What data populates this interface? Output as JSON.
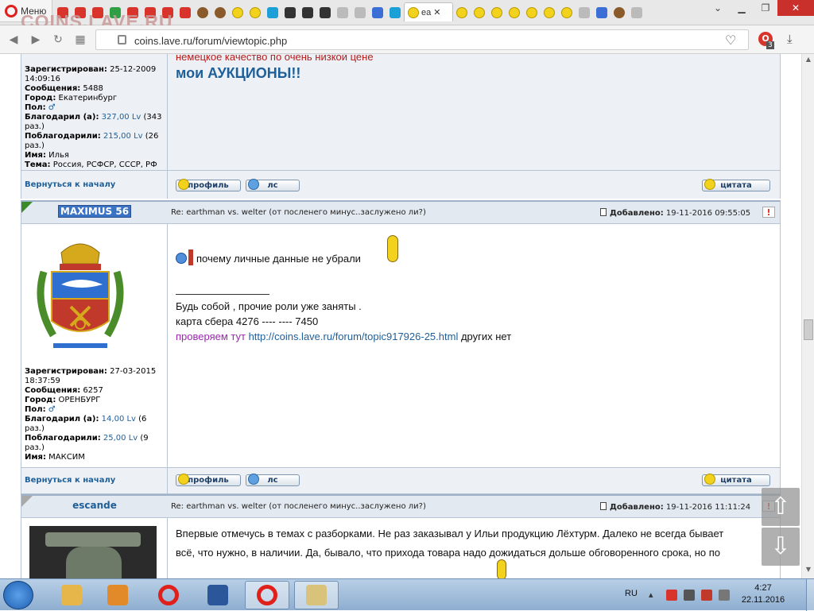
{
  "browser": {
    "menu_label": "Меню",
    "watermark": "COINS.LAVE.RU",
    "active_tab_label": "ea",
    "url": "coins.lave.ru/forum/viewtopic.php",
    "adblock_count": "3"
  },
  "top_post": {
    "red_line": "немецкое качество по очень низкой цене",
    "auction_link": "мои АУКЦИОНЫ!!",
    "profile": {
      "registered_label": "Зарегистрирован:",
      "registered_value": "25-12-2009 14:09:16",
      "messages_label": "Сообщения:",
      "messages_value": "5488",
      "city_label": "Город:",
      "city_value": "Екатеринбург",
      "gender_label": "Пол:",
      "thanked_label": "Благодарил (а):",
      "thanked_value": "327,00 Lv",
      "thanked_times": "(343 раз.)",
      "got_thanks_label": "Поблагодарили:",
      "got_thanks_value": "215,00 Lv",
      "got_thanks_times": "(26 раз.)",
      "name_label": "Имя:",
      "name_value": "Илья",
      "topic_label": "Тема:",
      "topic_value": "Россия, РСФСР, СССР, РФ"
    }
  },
  "buttons": {
    "back_to_top": "Вернуться к началу",
    "profile": "профиль",
    "pm": "лс",
    "quote": "цитата"
  },
  "post1": {
    "author": "MAXIMUS 56",
    "subject": "Re: earthman vs. welter (от послeнего минус..заслужено ли?)",
    "added_label": "Добавлено:",
    "added_value": "19-11-2016 09:55:05",
    "message": "почему личные данные не убрали",
    "sig_line1": "Будь собой , прочие роли уже заняты .",
    "sig_line2": "карта сбера 4276 ---- ---- 7450",
    "sig_check": "проверяем тут",
    "sig_link": "http://coins.lave.ru/forum/topic917926-25.html",
    "sig_tail": "других нет",
    "profile": {
      "registered_label": "Зарегистрирован:",
      "registered_value": "27-03-2015 18:37:59",
      "messages_label": "Сообщения:",
      "messages_value": "6257",
      "city_label": "Город:",
      "city_value": "ОРЕНБУРГ",
      "gender_label": "Пол:",
      "thanked_label": "Благодарил (а):",
      "thanked_value": "14,00 Lv",
      "thanked_times": "(6 раз.)",
      "got_thanks_label": "Поблагодарили:",
      "got_thanks_value": "25,00 Lv",
      "got_thanks_times": "(9 раз.)",
      "name_label": "Имя:",
      "name_value": "МАКСИМ"
    }
  },
  "post2": {
    "author": "escande",
    "subject": "Re: earthman vs. welter (от послeнего минус..заслужено ли?)",
    "added_label": "Добавлено:",
    "added_value": "19-11-2016 11:11:24",
    "line1": "Впервые отмечусь в темах с разборками. Не раз заказывал у Ильи продукцию Лёхтурм. Далеко не всегда бывает",
    "line2": "всё, что нужно, в наличии. Да, бывало, что прихода товара надо дожидаться дольше обговоренного срока, но по"
  },
  "taskbar": {
    "lang": "RU",
    "time": "4:27",
    "date": "22.11.2016"
  },
  "colors": {
    "link_blue": "#1f5f99",
    "red_text": "#b71c1c",
    "header_band": "#e3e9f0",
    "new_post_corner": "#3a8a2a"
  }
}
